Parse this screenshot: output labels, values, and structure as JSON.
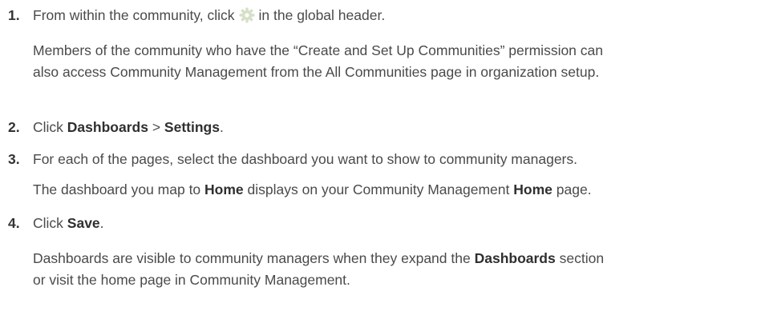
{
  "steps": [
    {
      "number": "1.",
      "text_before_icon": "From within the community, click",
      "icon": "gear-icon",
      "text_after_icon": "in the global header.",
      "detail_line1": "Members of the community who have the “Create and Set Up Communities” permission can",
      "detail_line2": "also access Community Management from the All Communities page in organization setup."
    },
    {
      "number": "2.",
      "text_prefix": "Click",
      "bold1": "Dashboards",
      "separator": ">",
      "bold2": "Settings",
      "suffix": "."
    },
    {
      "number": "3.",
      "text": "For each of the pages, select the dashboard you want to show to community managers.",
      "detail_prefix": "The dashboard you map to",
      "detail_bold1": "Home",
      "detail_middle": "displays on your Community Management",
      "detail_bold2": "Home",
      "detail_suffix": "page."
    },
    {
      "number": "4.",
      "text_prefix": "Click",
      "bold": "Save",
      "suffix": ".",
      "detail_prefix": "Dashboards are visible to community managers when they expand the",
      "detail_bold": "Dashboards",
      "detail_suffix": "section",
      "detail_line2": "or visit the home page in Community Management."
    }
  ],
  "colors": {
    "text": "#4a4a4a",
    "number": "#333333",
    "gear_icon": "#d6e0c8"
  }
}
